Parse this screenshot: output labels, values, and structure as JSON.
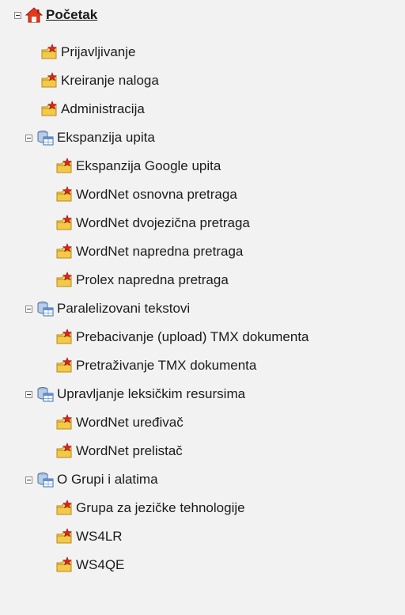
{
  "tree": {
    "root": {
      "label": "Početak",
      "icon": "home-icon"
    },
    "leaf_icon": "folder-star-icon",
    "group_icon": "database-table-icon",
    "items_top": [
      {
        "label": "Prijavljivanje"
      },
      {
        "label": "Kreiranje naloga"
      },
      {
        "label": "Administracija"
      }
    ],
    "groups": [
      {
        "label": "Ekspanzija upita",
        "items": [
          {
            "label": "Ekspanzija Google upita"
          },
          {
            "label": "WordNet osnovna pretraga"
          },
          {
            "label": "WordNet dvojezična pretraga"
          },
          {
            "label": "WordNet napredna pretraga"
          },
          {
            "label": "Prolex napredna pretraga"
          }
        ]
      },
      {
        "label": "Paralelizovani tekstovi",
        "items": [
          {
            "label": "Prebacivanje (upload) TMX dokumenta"
          },
          {
            "label": "Pretraživanje TMX dokumenta"
          }
        ]
      },
      {
        "label": "Upravljanje leksičkim resursima",
        "items": [
          {
            "label": "WordNet uređivač"
          },
          {
            "label": "WordNet prelistač"
          }
        ]
      },
      {
        "label": "O Grupi i alatima",
        "items": [
          {
            "label": "Grupa za jezičke tehnologije"
          },
          {
            "label": "WS4LR"
          },
          {
            "label": "WS4QE"
          }
        ]
      }
    ]
  }
}
